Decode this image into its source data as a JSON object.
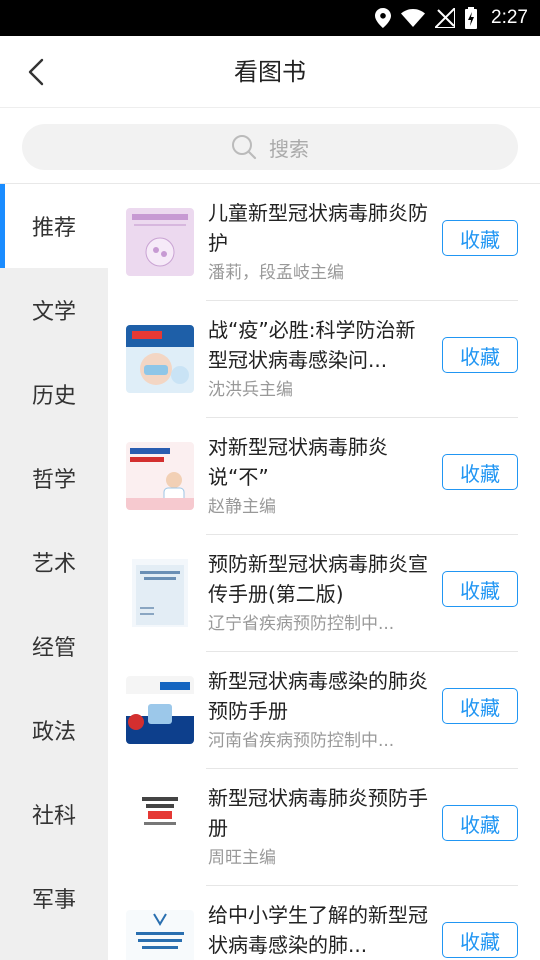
{
  "status": {
    "time": "2:27"
  },
  "header": {
    "title": "看图书"
  },
  "search": {
    "placeholder": "搜索"
  },
  "sidebar": {
    "items": [
      {
        "label": "推荐",
        "active": true
      },
      {
        "label": "文学"
      },
      {
        "label": "历史"
      },
      {
        "label": "哲学"
      },
      {
        "label": "艺术"
      },
      {
        "label": "经管"
      },
      {
        "label": "政法"
      },
      {
        "label": "社科"
      },
      {
        "label": "军事"
      }
    ]
  },
  "books": [
    {
      "title": "儿童新型冠状病毒肺炎防护",
      "author": "潘莉，段孟岐主编",
      "button": "收藏"
    },
    {
      "title": "战“疫”必胜:科学防治新型冠状病毒感染问...",
      "author": "沈洪兵主编",
      "button": "收藏"
    },
    {
      "title": "对新型冠状病毒肺炎说“不”",
      "author": "赵静主编",
      "button": "收藏"
    },
    {
      "title": "预防新型冠状病毒肺炎宣传手册(第二版)",
      "author": "辽宁省疾病预防控制中...",
      "button": "收藏"
    },
    {
      "title": "新型冠状病毒感染的肺炎预防手册",
      "author": "河南省疾病预防控制中...",
      "button": "收藏"
    },
    {
      "title": "新型冠状病毒肺炎预防手册",
      "author": "周旺主编",
      "button": "收藏"
    },
    {
      "title": "给中小学生了解的新型冠状病毒感染的肺...",
      "author": "",
      "button": "收藏"
    }
  ],
  "colors": {
    "accent": "#2196f3",
    "sidebar_bg": "#efefef",
    "active_indicator": "#1a8cff"
  }
}
